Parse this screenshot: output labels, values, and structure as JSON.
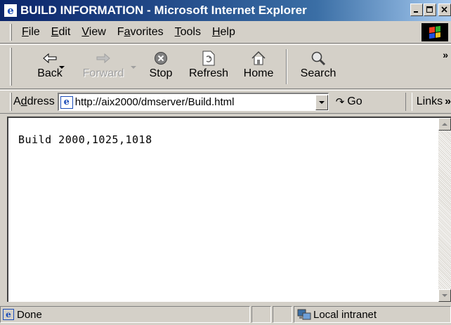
{
  "window": {
    "title": "BUILD INFORMATION - Microsoft Internet Explorer",
    "controls": {
      "minimize": "_",
      "maximize": "□",
      "close": "×"
    }
  },
  "menu": [
    {
      "label": "File"
    },
    {
      "label": "Edit"
    },
    {
      "label": "View"
    },
    {
      "label": "Favorites"
    },
    {
      "label": "Tools"
    },
    {
      "label": "Help"
    }
  ],
  "toolbar": {
    "back": "Back",
    "forward": "Forward",
    "stop": "Stop",
    "refresh": "Refresh",
    "home": "Home",
    "search": "Search",
    "more": "»"
  },
  "address": {
    "label": "Address",
    "url": "http://aix2000/dmserver/Build.html",
    "go": "Go",
    "links": "Links",
    "links_more": "»"
  },
  "content": {
    "text": "Build 2000,1025,1018"
  },
  "status": {
    "text": "Done",
    "zone": "Local intranet"
  },
  "colors": {
    "titlebar_start": "#0a246a",
    "titlebar_end": "#a6caf0",
    "chrome": "#d4d0c8",
    "page_background": "#ffffff"
  }
}
